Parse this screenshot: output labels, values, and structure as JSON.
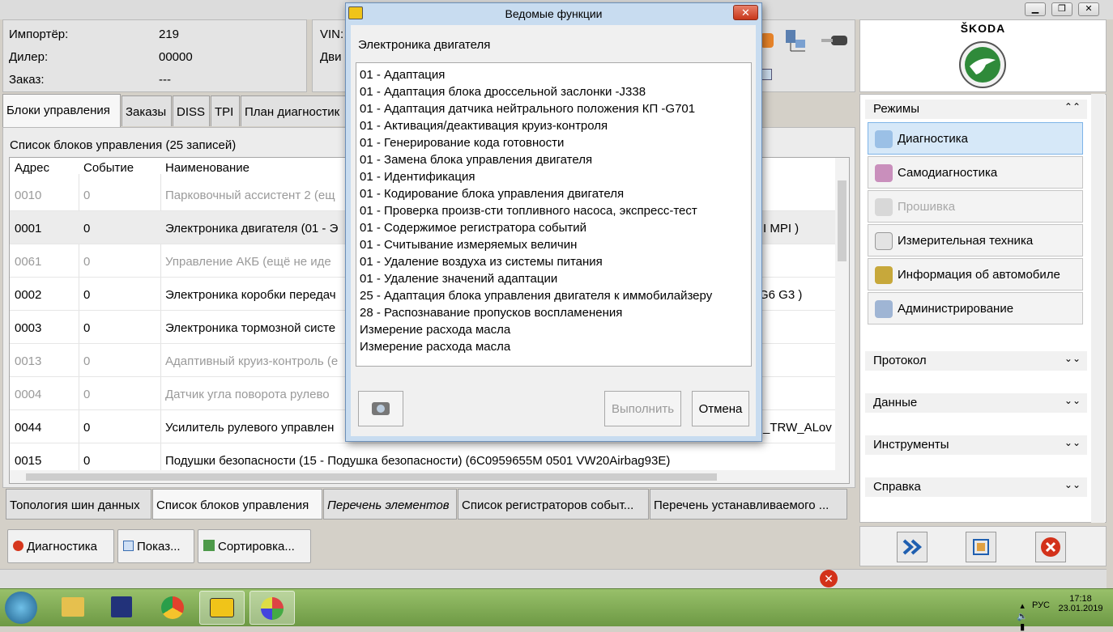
{
  "header": {
    "importer_label": "Импортёр:",
    "importer_value": "219",
    "dealer_label": "Дилер:",
    "dealer_value": "00000",
    "order_label": "Заказ:",
    "order_value": "---",
    "vin_label": "VIN:",
    "vin2_label": "Дви"
  },
  "brand": {
    "name": "ŠKODA"
  },
  "tabs": [
    "Блоки управления",
    "Заказы",
    "DISS",
    "TPI",
    "План диагностик"
  ],
  "list": {
    "title": "Список блоков управления (25 записей)",
    "columns": [
      "Адрес",
      "Событие",
      "Наименование"
    ],
    "rows": [
      {
        "addr": "0010",
        "event": "0",
        "name": "Парковочный ассистент 2 (ещ",
        "extra": ""
      },
      {
        "addr": "0001",
        "event": "0",
        "name": "Электроника двигателя (01 - Э",
        "extra": "I MPI  )"
      },
      {
        "addr": "0061",
        "event": "0",
        "name": "Управление АКБ (ещё не иде",
        "extra": ""
      },
      {
        "addr": "0002",
        "event": "0",
        "name": "Электроника коробки передач",
        "extra": "G6 G3 )"
      },
      {
        "addr": "0003",
        "event": "0",
        "name": "Электроника тормозной систе",
        "extra": ""
      },
      {
        "addr": "0013",
        "event": "0",
        "name": "Адаптивный круиз-контроль (е",
        "extra": ""
      },
      {
        "addr": "0004",
        "event": "0",
        "name": "Датчик угла поворота рулево",
        "extra": ""
      },
      {
        "addr": "0044",
        "event": "0",
        "name": "Усилитель рулевого управлен",
        "extra": "_TRW_ALov"
      },
      {
        "addr": "0015",
        "event": "0",
        "name": "Подушки безопасности (15 - Подушка безопасности) (6C0959655M    0501    VW20Airbag93E)",
        "extra": ""
      }
    ]
  },
  "bottom_tabs": [
    "Топология шин данных",
    "Список блоков управления",
    "Перечень элементов",
    "Список регистраторов событ...",
    "Перечень устанавливаемого ..."
  ],
  "buttons": {
    "diagnostics": "Диагностика",
    "show": "Показ...",
    "sort": "Сортировка..."
  },
  "right_panel": {
    "modes_title": "Режимы",
    "modes": [
      "Диагностика",
      "Самодиагностика",
      "Прошивка",
      "Измерительная техника",
      "Информация об автомобиле",
      "Администрирование"
    ],
    "sections": [
      "Протокол",
      "Данные",
      "Инструменты",
      "Справка"
    ]
  },
  "dialog": {
    "title": "Ведомые функции",
    "subtitle": "Электроника двигателя",
    "items": [
      "01 - Адаптация",
      "01 - Адаптация блока дроссельной заслонки -J338",
      "01 - Адаптация датчика нейтрального положения КП -G701",
      "01 - Активация/деактивация круиз-контроля",
      "01 - Генерирование кода готовности",
      "01 - Замена блока управления двигателя",
      "01 - Идентификация",
      "01 - Кодирование блока управления двигателя",
      "01 - Проверка произв-сти топливного насоса, экспресс-тест",
      "01 - Содержимое регистратора событий",
      "01 - Считывание измеряемых величин",
      "01 - Удаление воздуха из системы питания",
      "01 - Удаление значений адаптации",
      "25 - Адаптация блока управления двигателя к иммобилайзеру",
      "28 - Распознавание пропусков воспламенения",
      "Измерение расхода масла",
      "Измерение расхода масла"
    ],
    "execute": "Выполнить",
    "cancel": "Отмена"
  },
  "taskbar": {
    "lang": "РУС",
    "time": "17:18",
    "date": "23.01.2019"
  }
}
